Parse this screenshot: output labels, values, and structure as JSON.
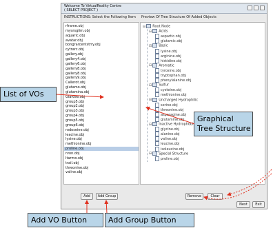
{
  "window": {
    "title_line1": "Welcome To VirtualReality Centre",
    "title_line2": "( SELECT PROJECT )"
  },
  "left_panel": {
    "header": "INSTRUCTIONS: Select the Following Item",
    "items": [
      "rframe.obj",
      "mysrsgiim.obj",
      "aquaric.obj",
      "avatar.obj",
      "bongrarcentstrry.obj",
      "cytrarc.obj",
      "gallery.obj",
      "gallery4.obj",
      "gallery6.obj",
      "gallery8.obj",
      "gallery8.obj",
      "gallery9.obj",
      "Callerot.obj",
      "glutamo.obj",
      "glutamina.obj",
      "Glarcee.obj",
      "group5.obj",
      "group2.obj",
      "group3.obj",
      "group4.obj",
      "group5.obj",
      "group6.obj",
      "rodoseine.obj",
      "leacine.obj",
      "lysine.obj",
      "methionine.obj",
      "proline.obj",
      "rvon.obj",
      "Itarmo.obj",
      "trail.obj",
      "threonine.obj",
      "valine.obj"
    ],
    "selected_index": 26
  },
  "right_panel": {
    "header": "Preview Of Tree Structure Of Added Objects",
    "tree": [
      {
        "label": "Root Node",
        "kind": "folder",
        "depth": 0,
        "toggle": "⊟"
      },
      {
        "label": "Acids",
        "kind": "folder",
        "depth": 1,
        "toggle": "⊟"
      },
      {
        "label": "aspartic.obj",
        "kind": "file",
        "depth": 2
      },
      {
        "label": "glutamic.obj",
        "kind": "file",
        "depth": 2
      },
      {
        "label": "Basic",
        "kind": "folder",
        "depth": 1,
        "toggle": "⊟"
      },
      {
        "label": "lysine.obj",
        "kind": "file",
        "depth": 2
      },
      {
        "label": "arginine.obj",
        "kind": "file",
        "depth": 2
      },
      {
        "label": "histidine.obj",
        "kind": "file",
        "depth": 2
      },
      {
        "label": "Aromatic",
        "kind": "folder",
        "depth": 1,
        "toggle": "⊟"
      },
      {
        "label": "tyrosine.obj",
        "kind": "file",
        "depth": 2
      },
      {
        "label": "tryptophan.obj",
        "kind": "file",
        "depth": 2
      },
      {
        "label": "phenylalanine.obj",
        "kind": "file",
        "depth": 2
      },
      {
        "label": "Sulfur",
        "kind": "folder",
        "depth": 1,
        "toggle": "⊟"
      },
      {
        "label": "cysteine.obj",
        "kind": "file",
        "depth": 2
      },
      {
        "label": "methionine.obj",
        "kind": "file",
        "depth": 2
      },
      {
        "label": "Uncharged Hydrophilic",
        "kind": "folder",
        "depth": 1,
        "toggle": "⊟"
      },
      {
        "label": "serine.obj",
        "kind": "file",
        "depth": 2
      },
      {
        "label": "threonine.obj",
        "kind": "file",
        "depth": 2
      },
      {
        "label": "asparagine.obj",
        "kind": "file",
        "depth": 2
      },
      {
        "label": "glutamine.obj",
        "kind": "file",
        "depth": 2
      },
      {
        "label": "Inactive Hydrophobic",
        "kind": "folder",
        "depth": 1,
        "toggle": "⊟"
      },
      {
        "label": "glycine.obj",
        "kind": "file",
        "depth": 2
      },
      {
        "label": "alanine.obj",
        "kind": "file",
        "depth": 2
      },
      {
        "label": "valine.obj",
        "kind": "file",
        "depth": 2
      },
      {
        "label": "leucine.obj",
        "kind": "file",
        "depth": 2
      },
      {
        "label": "isoleucine.obj",
        "kind": "file",
        "depth": 2
      },
      {
        "label": "Special Structure",
        "kind": "folder",
        "depth": 1,
        "toggle": "⊟"
      },
      {
        "label": "proline.obj",
        "kind": "file",
        "depth": 2
      }
    ]
  },
  "buttons": {
    "add": "Add",
    "add_group": "Add Group",
    "remove": "Remove",
    "clear": "Clear",
    "next": "Next",
    "exit": "Exit"
  },
  "annotations": {
    "list_of_vos": "List of VOs",
    "graphical_tree_line1": "Graphical",
    "graphical_tree_line2": "Tree Structure",
    "add_vo_button": "Add VO Button",
    "add_group_button": "Add Group Button"
  },
  "colors": {
    "callout_fill": "#b9d5e8",
    "arrow_red": "#e0301e",
    "selection": "#b8cde6"
  }
}
